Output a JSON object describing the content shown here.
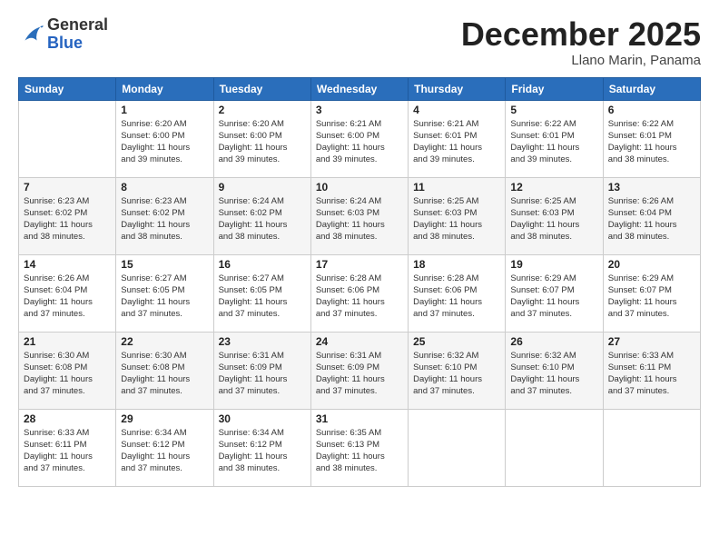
{
  "header": {
    "logo_general": "General",
    "logo_blue": "Blue",
    "month_title": "December 2025",
    "subtitle": "Llano Marin, Panama"
  },
  "days_of_week": [
    "Sunday",
    "Monday",
    "Tuesday",
    "Wednesday",
    "Thursday",
    "Friday",
    "Saturday"
  ],
  "weeks": [
    [
      {
        "day": "",
        "info": ""
      },
      {
        "day": "1",
        "info": "Sunrise: 6:20 AM\nSunset: 6:00 PM\nDaylight: 11 hours\nand 39 minutes."
      },
      {
        "day": "2",
        "info": "Sunrise: 6:20 AM\nSunset: 6:00 PM\nDaylight: 11 hours\nand 39 minutes."
      },
      {
        "day": "3",
        "info": "Sunrise: 6:21 AM\nSunset: 6:00 PM\nDaylight: 11 hours\nand 39 minutes."
      },
      {
        "day": "4",
        "info": "Sunrise: 6:21 AM\nSunset: 6:01 PM\nDaylight: 11 hours\nand 39 minutes."
      },
      {
        "day": "5",
        "info": "Sunrise: 6:22 AM\nSunset: 6:01 PM\nDaylight: 11 hours\nand 39 minutes."
      },
      {
        "day": "6",
        "info": "Sunrise: 6:22 AM\nSunset: 6:01 PM\nDaylight: 11 hours\nand 38 minutes."
      }
    ],
    [
      {
        "day": "7",
        "info": "Sunrise: 6:23 AM\nSunset: 6:02 PM\nDaylight: 11 hours\nand 38 minutes."
      },
      {
        "day": "8",
        "info": "Sunrise: 6:23 AM\nSunset: 6:02 PM\nDaylight: 11 hours\nand 38 minutes."
      },
      {
        "day": "9",
        "info": "Sunrise: 6:24 AM\nSunset: 6:02 PM\nDaylight: 11 hours\nand 38 minutes."
      },
      {
        "day": "10",
        "info": "Sunrise: 6:24 AM\nSunset: 6:03 PM\nDaylight: 11 hours\nand 38 minutes."
      },
      {
        "day": "11",
        "info": "Sunrise: 6:25 AM\nSunset: 6:03 PM\nDaylight: 11 hours\nand 38 minutes."
      },
      {
        "day": "12",
        "info": "Sunrise: 6:25 AM\nSunset: 6:03 PM\nDaylight: 11 hours\nand 38 minutes."
      },
      {
        "day": "13",
        "info": "Sunrise: 6:26 AM\nSunset: 6:04 PM\nDaylight: 11 hours\nand 38 minutes."
      }
    ],
    [
      {
        "day": "14",
        "info": "Sunrise: 6:26 AM\nSunset: 6:04 PM\nDaylight: 11 hours\nand 37 minutes."
      },
      {
        "day": "15",
        "info": "Sunrise: 6:27 AM\nSunset: 6:05 PM\nDaylight: 11 hours\nand 37 minutes."
      },
      {
        "day": "16",
        "info": "Sunrise: 6:27 AM\nSunset: 6:05 PM\nDaylight: 11 hours\nand 37 minutes."
      },
      {
        "day": "17",
        "info": "Sunrise: 6:28 AM\nSunset: 6:06 PM\nDaylight: 11 hours\nand 37 minutes."
      },
      {
        "day": "18",
        "info": "Sunrise: 6:28 AM\nSunset: 6:06 PM\nDaylight: 11 hours\nand 37 minutes."
      },
      {
        "day": "19",
        "info": "Sunrise: 6:29 AM\nSunset: 6:07 PM\nDaylight: 11 hours\nand 37 minutes."
      },
      {
        "day": "20",
        "info": "Sunrise: 6:29 AM\nSunset: 6:07 PM\nDaylight: 11 hours\nand 37 minutes."
      }
    ],
    [
      {
        "day": "21",
        "info": "Sunrise: 6:30 AM\nSunset: 6:08 PM\nDaylight: 11 hours\nand 37 minutes."
      },
      {
        "day": "22",
        "info": "Sunrise: 6:30 AM\nSunset: 6:08 PM\nDaylight: 11 hours\nand 37 minutes."
      },
      {
        "day": "23",
        "info": "Sunrise: 6:31 AM\nSunset: 6:09 PM\nDaylight: 11 hours\nand 37 minutes."
      },
      {
        "day": "24",
        "info": "Sunrise: 6:31 AM\nSunset: 6:09 PM\nDaylight: 11 hours\nand 37 minutes."
      },
      {
        "day": "25",
        "info": "Sunrise: 6:32 AM\nSunset: 6:10 PM\nDaylight: 11 hours\nand 37 minutes."
      },
      {
        "day": "26",
        "info": "Sunrise: 6:32 AM\nSunset: 6:10 PM\nDaylight: 11 hours\nand 37 minutes."
      },
      {
        "day": "27",
        "info": "Sunrise: 6:33 AM\nSunset: 6:11 PM\nDaylight: 11 hours\nand 37 minutes."
      }
    ],
    [
      {
        "day": "28",
        "info": "Sunrise: 6:33 AM\nSunset: 6:11 PM\nDaylight: 11 hours\nand 37 minutes."
      },
      {
        "day": "29",
        "info": "Sunrise: 6:34 AM\nSunset: 6:12 PM\nDaylight: 11 hours\nand 37 minutes."
      },
      {
        "day": "30",
        "info": "Sunrise: 6:34 AM\nSunset: 6:12 PM\nDaylight: 11 hours\nand 38 minutes."
      },
      {
        "day": "31",
        "info": "Sunrise: 6:35 AM\nSunset: 6:13 PM\nDaylight: 11 hours\nand 38 minutes."
      },
      {
        "day": "",
        "info": ""
      },
      {
        "day": "",
        "info": ""
      },
      {
        "day": "",
        "info": ""
      }
    ]
  ]
}
